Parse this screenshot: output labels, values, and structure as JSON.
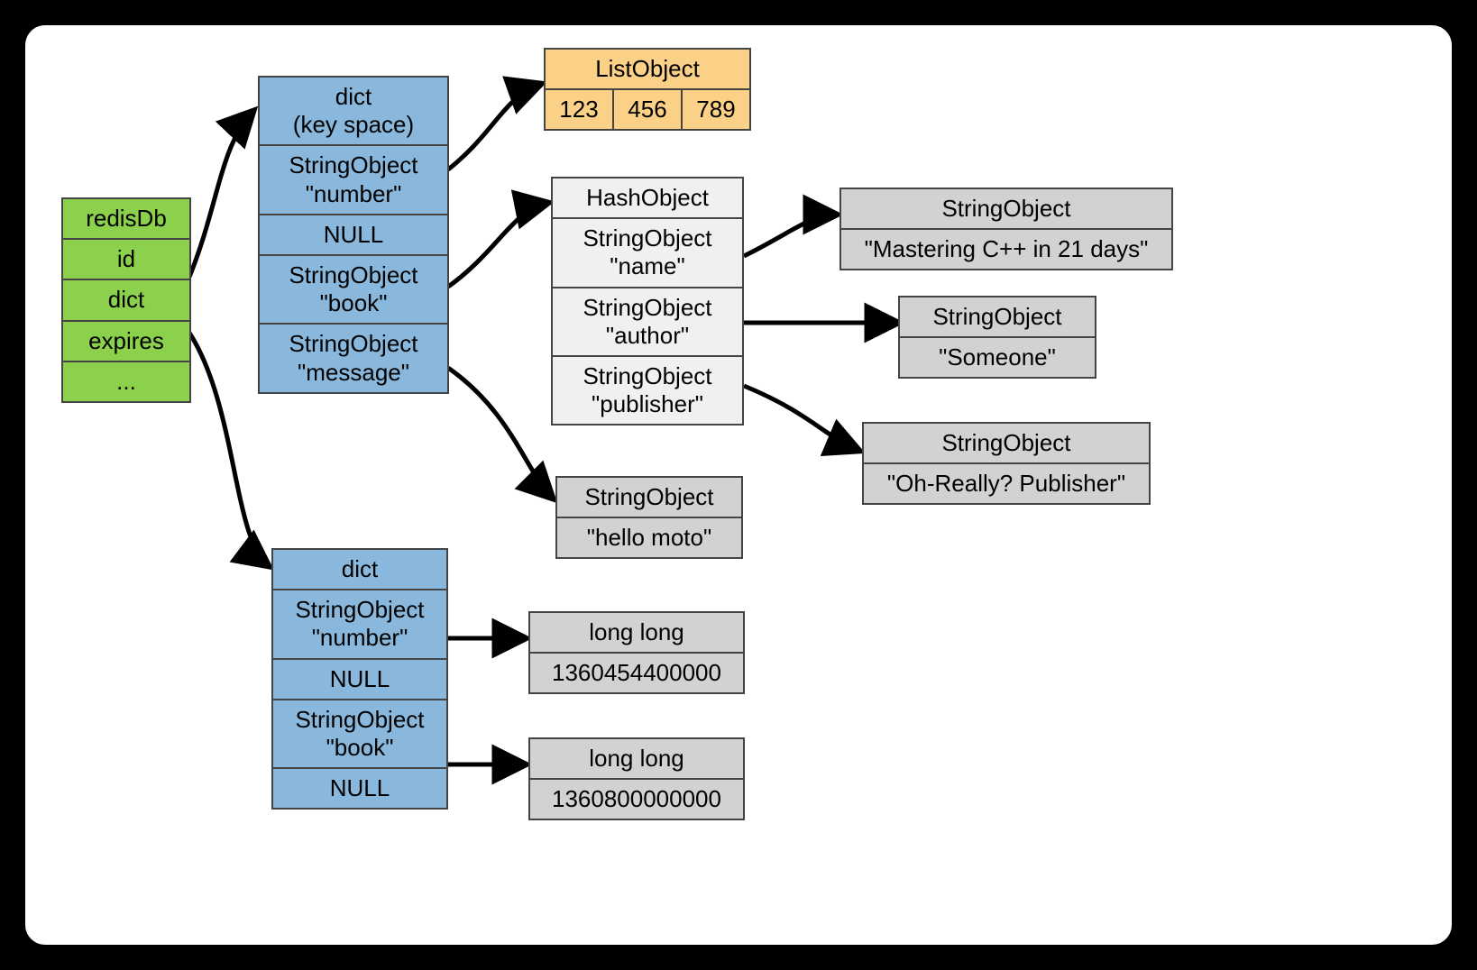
{
  "redisDb": {
    "title": "redisDb",
    "rows": [
      "id",
      "dict",
      "expires",
      "..."
    ]
  },
  "dictKeyspace": {
    "title_l1": "dict",
    "title_l2": "(key space)",
    "entries": [
      {
        "type": "StringObject",
        "value": "\"number\""
      },
      {
        "type": "NULL"
      },
      {
        "type": "StringObject",
        "value": "\"book\""
      },
      {
        "type": "StringObject",
        "value": "\"message\""
      }
    ]
  },
  "listObject": {
    "title": "ListObject",
    "items": [
      "123",
      "456",
      "789"
    ]
  },
  "hashObject": {
    "title": "HashObject",
    "fields": [
      {
        "type": "StringObject",
        "name": "\"name\""
      },
      {
        "type": "StringObject",
        "name": "\"author\""
      },
      {
        "type": "StringObject",
        "name": "\"publisher\""
      }
    ]
  },
  "stringValues": {
    "mastering": {
      "title": "StringObject",
      "value": "\"Mastering C++ in 21 days\""
    },
    "someone": {
      "title": "StringObject",
      "value": "\"Someone\""
    },
    "publisher": {
      "title": "StringObject",
      "value": "\"Oh-Really? Publisher\""
    },
    "hello": {
      "title": "StringObject",
      "value": "\"hello moto\""
    }
  },
  "expiresDict": {
    "title": "dict",
    "entries": [
      {
        "type": "StringObject",
        "value": "\"number\""
      },
      {
        "type": "NULL"
      },
      {
        "type": "StringObject",
        "value": "\"book\""
      },
      {
        "type": "NULL"
      }
    ]
  },
  "longValues": {
    "number": {
      "title": "long long",
      "value": "1360454400000"
    },
    "book": {
      "title": "long long",
      "value": "1360800000000"
    }
  }
}
